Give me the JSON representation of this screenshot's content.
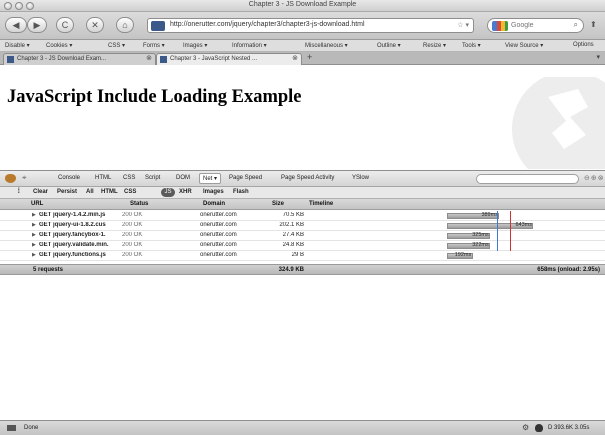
{
  "window": {
    "title": "Chapter 3 - JS Download Example"
  },
  "nav": {
    "back": "◀",
    "forward": "▶",
    "reload": "C",
    "stop": "✕",
    "home": "⌂",
    "url": "http://onerutter.com/jquery/chapter3/chapter3-js-download.html",
    "search_placeholder": "Google",
    "search_icon": "magnifier-icon"
  },
  "devtoolbar": {
    "items": [
      "Disable ▾",
      "Cookies ▾",
      "CSS ▾",
      "Forms ▾",
      "Images ▾",
      "Information ▾",
      "Miscellaneous ▾",
      "Outline ▾",
      "Resize ▾",
      "Tools ▾",
      "View Source ▾",
      "Options"
    ]
  },
  "tabs": [
    {
      "label": "Chapter 3 - JS Download Exam...",
      "close": "⊗"
    },
    {
      "label": "Chapter 3 - JavaScript Nested ...",
      "close": "⊗"
    }
  ],
  "new_tab": "+",
  "page": {
    "heading": "JavaScript Include Loading Example"
  },
  "firebug": {
    "panels": [
      "Console",
      "HTML",
      "CSS",
      "Script",
      "DOM",
      "Net ▾",
      "Page Speed",
      "Page Speed Activity",
      "YSlow"
    ],
    "filters": [
      "Clear",
      "Persist",
      "All",
      "HTML",
      "CSS",
      "JS",
      "XHR",
      "Images",
      "Flash"
    ],
    "columns": [
      "URL",
      "Status",
      "Domain",
      "Size",
      "Timeline"
    ],
    "requests": [
      {
        "url": "GET jquery-1.4.2.min.js",
        "status": "200 OK",
        "domain": "onerutter.com",
        "size": "70.5 KB",
        "timing": "389ms",
        "start": 0.0,
        "fraction": 0.57
      },
      {
        "url": "GET jquery-ui-1.8.2.cus",
        "status": "200 OK",
        "domain": "onerutter.com",
        "size": "202.1 KB",
        "timing": "643ms",
        "start": 0.0,
        "fraction": 0.94
      },
      {
        "url": "GET jquery.fancybox-1.",
        "status": "200 OK",
        "domain": "onerutter.com",
        "size": "27.4 KB",
        "timing": "325ms",
        "start": 0.0,
        "fraction": 0.47
      },
      {
        "url": "GET jquery.validate.min.",
        "status": "200 OK",
        "domain": "onerutter.com",
        "size": "24.8 KB",
        "timing": "322ms",
        "start": 0.0,
        "fraction": 0.47
      },
      {
        "url": "GET jquery.functions.js",
        "status": "200 OK",
        "domain": "onerutter.com",
        "size": "29 B",
        "timing": "192ms",
        "start": 0.0,
        "fraction": 0.28
      }
    ],
    "summary": {
      "count": "5 requests",
      "total_size": "324.9 KB",
      "total_time": "658ms (onload: 2.95s)"
    }
  },
  "status": {
    "text": "Done",
    "right": "D  393.6K  3.05s"
  }
}
